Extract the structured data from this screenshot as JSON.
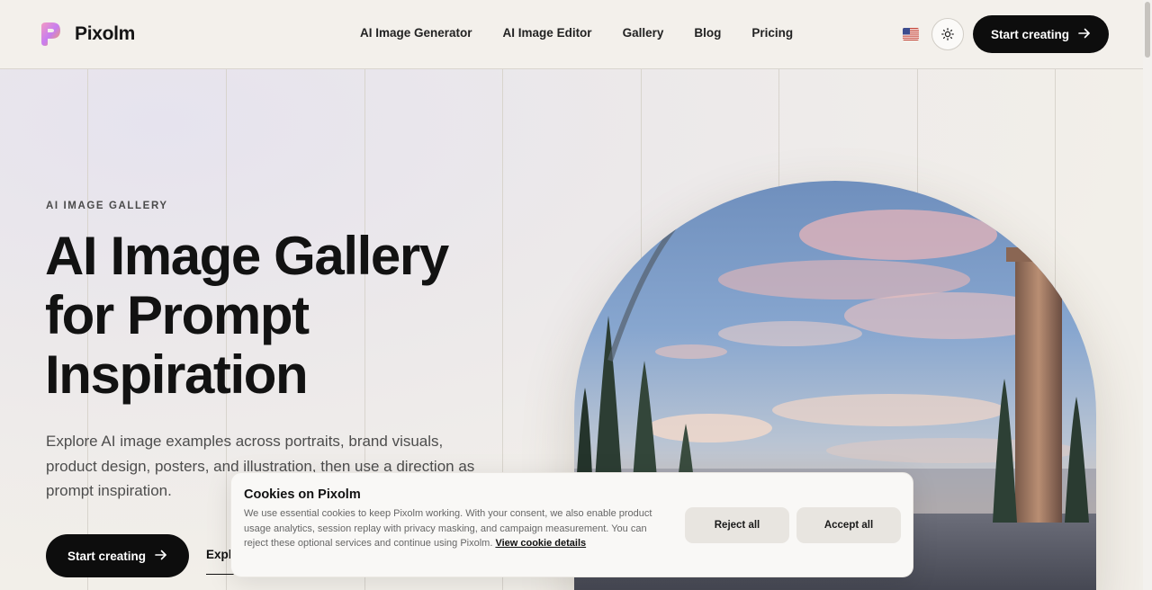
{
  "header": {
    "brand": "Pixolm",
    "nav": [
      "AI Image Generator",
      "AI Image Editor",
      "Gallery",
      "Blog",
      "Pricing"
    ],
    "language_flag": "🇺🇸",
    "theme_icon": "sun-icon",
    "cta_label": "Start creating"
  },
  "hero": {
    "eyebrow": "AI IMAGE GALLERY",
    "title_line1": "AI Image Gallery",
    "title_line2": "for Prompt",
    "title_line3": "Inspiration",
    "description": "Explore AI image examples across portraits, brand visuals, product design, posters, and illustration, then use a direction as prompt inspiration.",
    "primary_cta": "Start creating",
    "secondary_cta": "Explore"
  },
  "cookie_banner": {
    "title": "Cookies on Pixolm",
    "text": "We use essential cookies to keep Pixolm working. With your consent, we also enable product usage analytics, session replay with privacy masking, and campaign measurement. You can reject these optional services and continue using Pixolm.",
    "link": "View cookie details",
    "reject_label": "Reject all",
    "accept_label": "Accept all"
  },
  "colors": {
    "background": "#f1eee8",
    "primary": "#0d0d0d",
    "button_secondary": "#e8e5e0"
  }
}
